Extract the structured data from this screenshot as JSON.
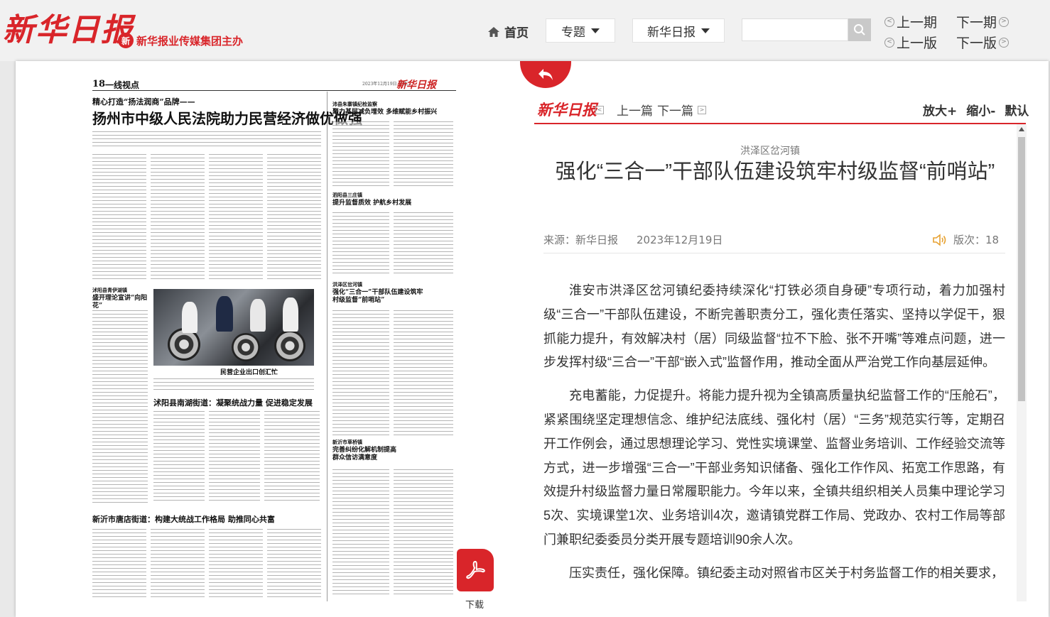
{
  "header": {
    "logo_text": "新华日报",
    "sponsor_text": "新华报业传媒集团主办",
    "nav_home": "首页",
    "topic_dropdown": "专题",
    "paper_dropdown": "新华日报",
    "search": {
      "value": "",
      "placeholder": ""
    },
    "prev_issue": "上一期",
    "next_issue": "下一期",
    "prev_page": "上一版",
    "next_page": "下一版"
  },
  "newspaper": {
    "page_number": "18",
    "section": "一线视点",
    "date_line": "2023年12月19日 星期二",
    "logo": "新华日报",
    "kicker_main": "精心打造“扬法润商”品牌——",
    "headline_main": "扬州市中级人民法院助力民营经济做优做强",
    "right_col": [
      {
        "kicker": "沛县朱寨镇纪检监察",
        "headline": "聚力基层减负增效 多维赋能乡村振兴"
      },
      {
        "kicker": "泗阳县三庄镇",
        "headline": "提升监督质效 护航乡村发展"
      },
      {
        "kicker": "洪泽区岔河镇",
        "headline": "强化“三合一”干部队伍建设筑牢村级监督“前哨站”"
      },
      {
        "kicker": "新沂市草桥镇",
        "headline": "完善纠纷化解机制提高群众信访满意度"
      }
    ],
    "left_col_kicker": "沭阳县青伊湖镇",
    "left_col_headline": "盛开理论宣讲“向阳花”",
    "photo_caption": "民营企业出口创汇忙",
    "mid_headline": "沭阳县南湖街道：凝聚统战力量 促进稳定发展",
    "bottom_headline": "新沂市唐店街道：构建大统战工作格局 助推同心共富"
  },
  "download_label": "下载",
  "article_nav": {
    "logo": "新华日报",
    "prev": "上一篇",
    "next": "下一篇",
    "zoom_in": "放大+",
    "zoom_out": "缩小-",
    "zoom_default": "默认"
  },
  "article": {
    "kicker": "洪泽区岔河镇",
    "title": "强化“三合一”干部队伍建设筑牢村级监督“前哨站”",
    "source": "来源：新华日报",
    "date": "2023年12月19日",
    "page_label": "版次：18",
    "paragraphs": [
      "淮安市洪泽区岔河镇纪委持续深化“打铁必须自身硬”专项行动，着力加强村级“三合一”干部队伍建设，不断完善职责分工，强化责任落实、坚持以学促干，狠抓能力提升，有效解决村（居）同级监督“拉不下脸、张不开嘴”等难点问题，进一步发挥村级“三合一”干部“嵌入式”监督作用，推动全面从严治党工作向基层延伸。",
      "充电蓄能，力促提升。将能力提升视为全镇高质量执纪监督工作的“压舱石”，紧紧围绕坚定理想信念、维护纪法底线、强化村（居）“三务”规范实行等，定期召开工作例会，通过思想理论学习、党性实境课堂、监督业务培训、工作经验交流等方式，进一步增强“三合一”干部业务知识储备、强化工作作风、拓宽工作思路，有效提升村级监督力量日常履职能力。今年以来，全镇共组织相关人员集中理论学习5次、实境课堂1次、业务培训4次，邀请镇党群工作局、党政办、农村工作局等部门兼职纪委委员分类开展专题培训90余人次。",
      "压实责任，强化保障。镇纪委主动对照省市区关于村务监督工作的相关要求，"
    ]
  },
  "colors": {
    "brand_red": "#d9252a",
    "text": "#333333",
    "muted": "#777777"
  }
}
